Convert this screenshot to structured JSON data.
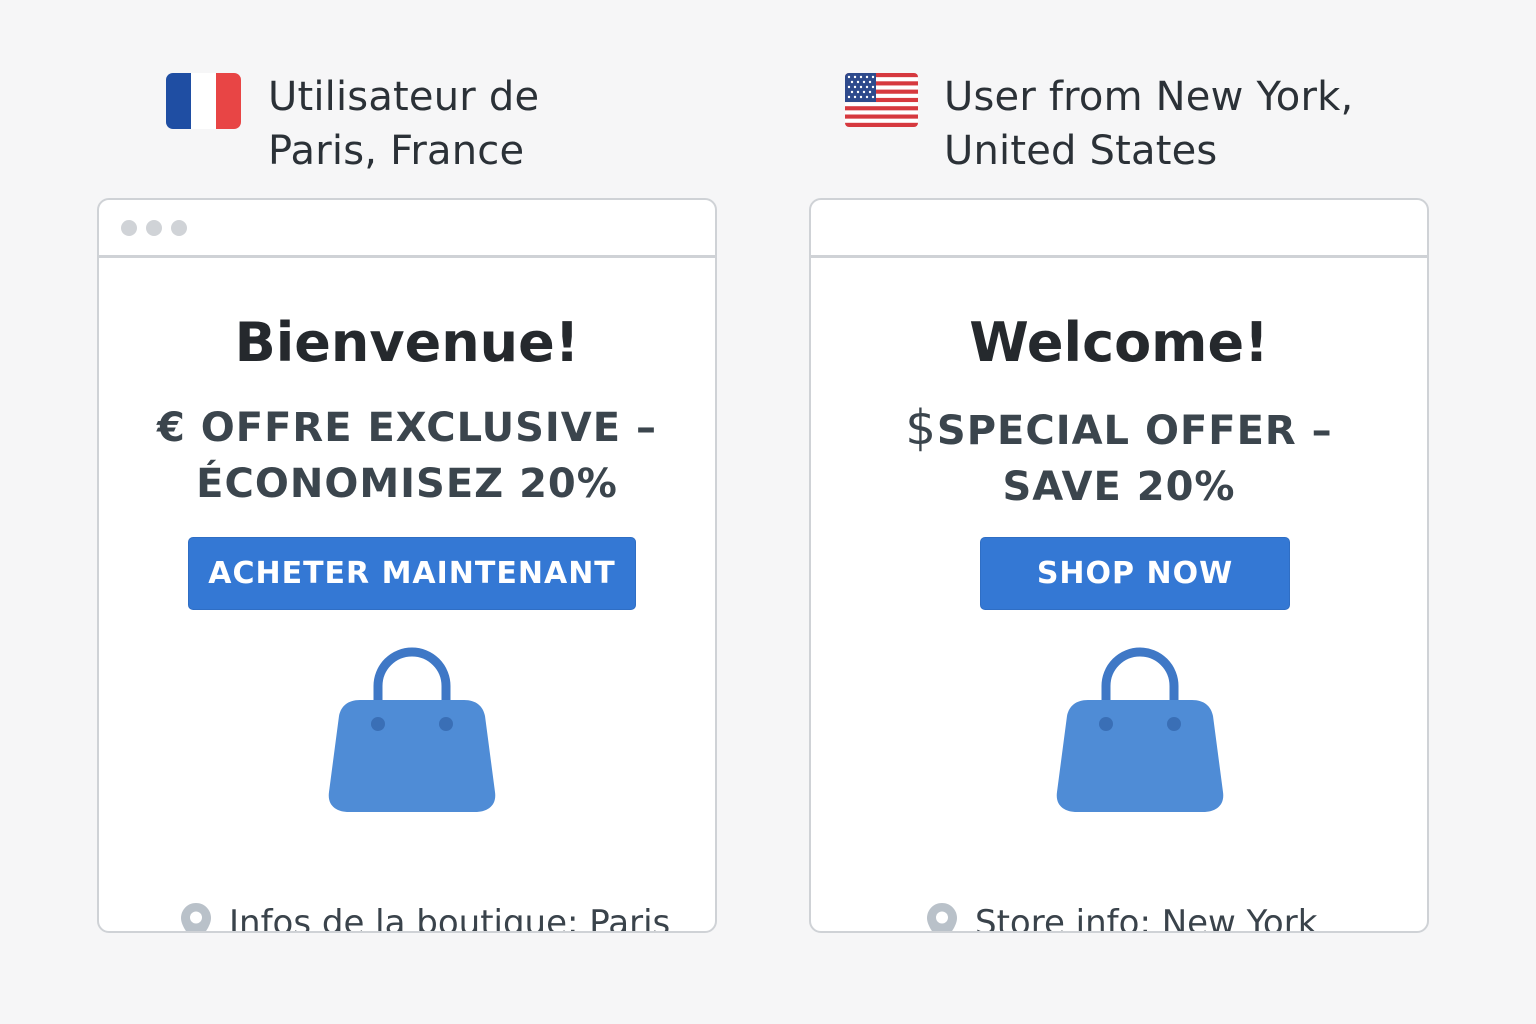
{
  "left_panel": {
    "caption": "Utilisateur de\nParis, France",
    "flag_icon": "france-flag-icon",
    "window": {
      "welcome": "Bienvenue!",
      "offer_currency": "€",
      "offer_line1": "OFFRE EXCLUSIVE –",
      "offer_line2": "ÉCONOMISEZ 20%",
      "cta_label": "ACHETER MAINTENANT",
      "product_icon": "shopping-bag-icon",
      "store_icon": "location-pin-icon",
      "store_info": "Infos de la boutique: Paris"
    }
  },
  "right_panel": {
    "caption": "User from New York,\nUnited States",
    "flag_icon": "usa-flag-icon",
    "window": {
      "welcome": "Welcome!",
      "offer_currency": "$",
      "offer_line1": "SPECIAL OFFER –",
      "offer_line2": "SAVE 20%",
      "cta_label": "SHOP NOW",
      "product_icon": "shopping-bag-icon",
      "store_icon": "location-pin-icon",
      "store_info": "Store info: New York"
    }
  },
  "colors": {
    "background": "#f6f6f7",
    "accent_blue": "#3478d4",
    "bag_blue": "#4f8cd6",
    "border": "#cfd2d6",
    "pin_gray": "#b9c1c9"
  }
}
